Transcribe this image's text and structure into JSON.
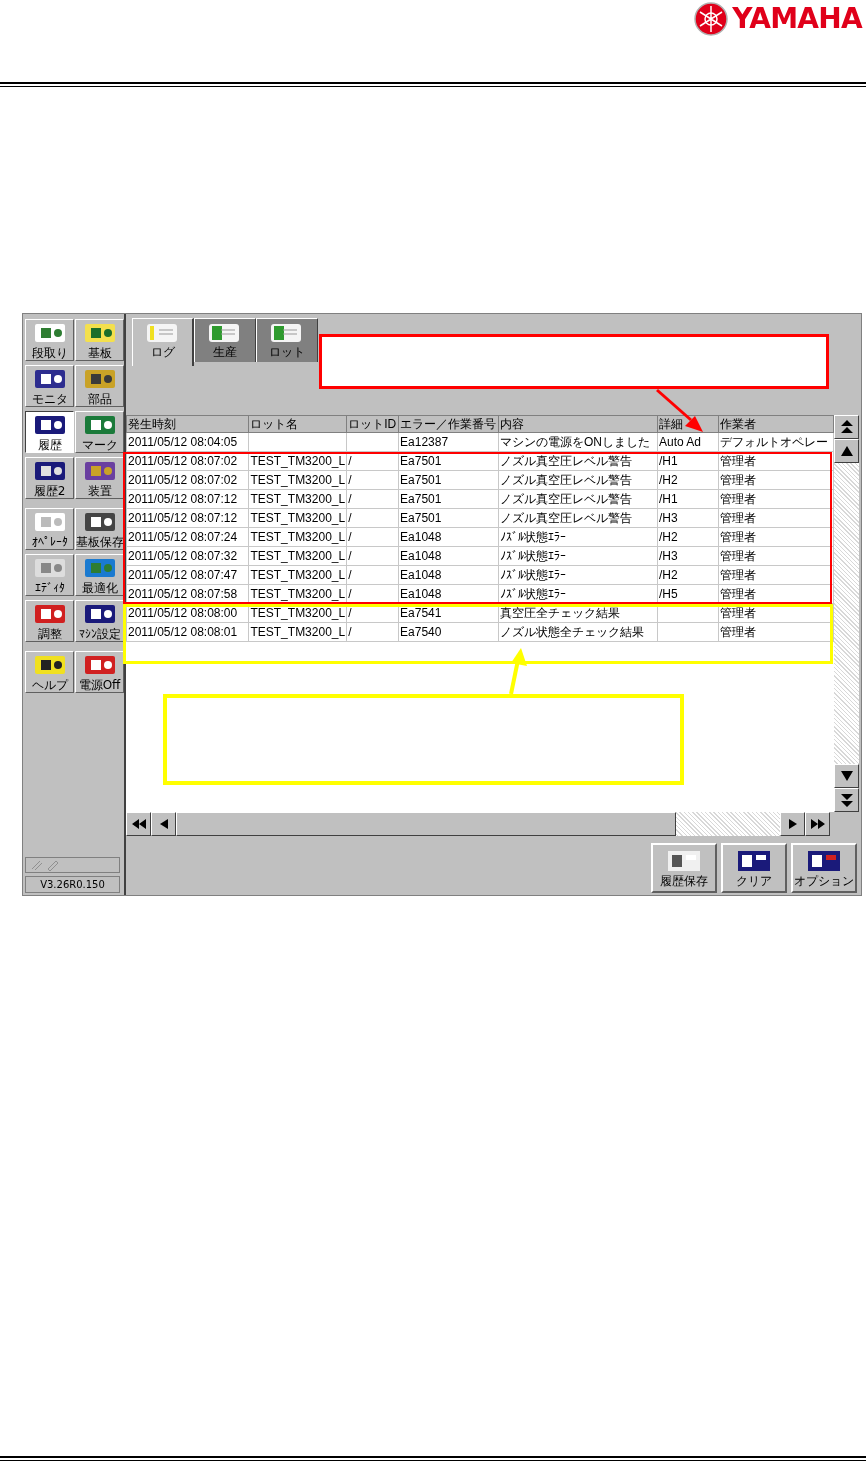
{
  "header": {
    "logo_text": "YAMAHA"
  },
  "sidebar": {
    "groups": [
      [
        {
          "label": "段取り",
          "selected": false
        },
        {
          "label": "基板",
          "selected": false
        },
        {
          "label": "モニタ",
          "selected": false
        },
        {
          "label": "部品",
          "selected": false
        },
        {
          "label": "履歴",
          "selected": true
        },
        {
          "label": "マーク",
          "selected": false
        },
        {
          "label": "履歴2",
          "selected": false
        },
        {
          "label": "装置",
          "selected": false
        }
      ],
      [
        {
          "label": "ｵﾍﾟﾚｰﾀ",
          "selected": false
        },
        {
          "label": "基板保存",
          "selected": false
        },
        {
          "label": "ｴﾃﾞｨﾀ",
          "selected": false
        },
        {
          "label": "最適化",
          "selected": false
        },
        {
          "label": "調整",
          "selected": false
        },
        {
          "label": "ﾏｼﾝ設定",
          "selected": false
        }
      ],
      [
        {
          "label": "ヘルプ",
          "selected": false
        },
        {
          "label": "電源Off",
          "selected": false
        }
      ]
    ],
    "version": "V3.26R0.150"
  },
  "tabs": [
    {
      "label": "ログ",
      "selected": true
    },
    {
      "label": "生産",
      "selected": false
    },
    {
      "label": "ロット",
      "selected": false
    }
  ],
  "table": {
    "columns": [
      "発生時刻",
      "ロット名",
      "ロットID",
      "エラー／作業番号",
      "内容",
      "詳細",
      "作業者"
    ],
    "rows": [
      [
        "2011/05/12 08:04:05",
        "",
        "",
        "Ea12387",
        "マシンの電源をONしました",
        "Auto Ad",
        "デフォルトオペレー"
      ],
      [
        "2011/05/12 08:07:02",
        "TEST_TM3200_L",
        "/",
        "Ea7501",
        "ノズル真空圧レベル警告",
        "/H1",
        "管理者"
      ],
      [
        "2011/05/12 08:07:02",
        "TEST_TM3200_L",
        "/",
        "Ea7501",
        "ノズル真空圧レベル警告",
        "/H2",
        "管理者"
      ],
      [
        "2011/05/12 08:07:12",
        "TEST_TM3200_L",
        "/",
        "Ea7501",
        "ノズル真空圧レベル警告",
        "/H1",
        "管理者"
      ],
      [
        "2011/05/12 08:07:12",
        "TEST_TM3200_L",
        "/",
        "Ea7501",
        "ノズル真空圧レベル警告",
        "/H3",
        "管理者"
      ],
      [
        "2011/05/12 08:07:24",
        "TEST_TM3200_L",
        "/",
        "Ea1048",
        "ﾉｽﾞﾙ状態ｴﾗｰ",
        "/H2",
        "管理者"
      ],
      [
        "2011/05/12 08:07:32",
        "TEST_TM3200_L",
        "/",
        "Ea1048",
        "ﾉｽﾞﾙ状態ｴﾗｰ",
        "/H3",
        "管理者"
      ],
      [
        "2011/05/12 08:07:47",
        "TEST_TM3200_L",
        "/",
        "Ea1048",
        "ﾉｽﾞﾙ状態ｴﾗｰ",
        "/H2",
        "管理者"
      ],
      [
        "2011/05/12 08:07:58",
        "TEST_TM3200_L",
        "/",
        "Ea1048",
        "ﾉｽﾞﾙ状態ｴﾗｰ",
        "/H5",
        "管理者"
      ],
      [
        "2011/05/12 08:08:00",
        "TEST_TM3200_L",
        "/",
        "Ea7541",
        "真空圧全チェック結果",
        "",
        "管理者"
      ],
      [
        "2011/05/12 08:08:01",
        "TEST_TM3200_L",
        "/",
        "Ea7540",
        "ノズル状態全チェック結果",
        "",
        "管理者"
      ]
    ]
  },
  "actions": [
    {
      "label": "履歴保存"
    },
    {
      "label": "クリア"
    },
    {
      "label": "オプション"
    }
  ]
}
